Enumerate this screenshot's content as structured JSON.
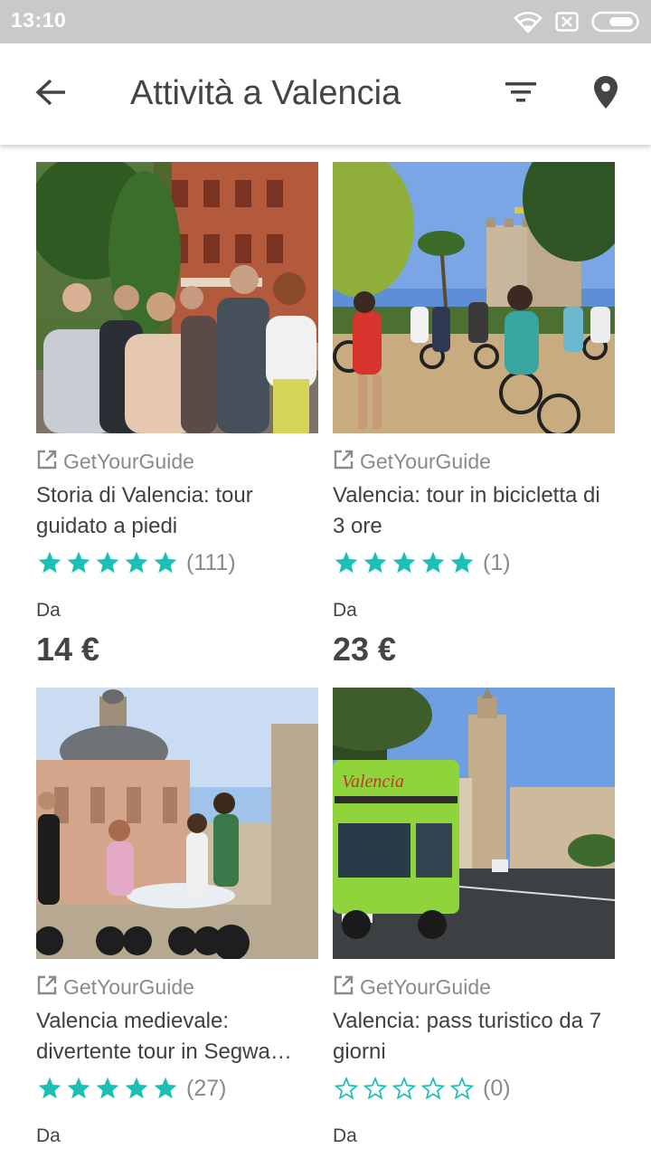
{
  "status_bar": {
    "time": "13:10",
    "icons": [
      "wifi-icon",
      "sim-missing-icon",
      "battery-icon"
    ]
  },
  "header": {
    "title": "Attività a Valencia",
    "icons": [
      "back-arrow-icon",
      "filter-icon",
      "map-pin-icon"
    ]
  },
  "colors": {
    "accent": "#1bbfb7",
    "status_bar": "#c9c9c9",
    "muted_text": "#8a8a8a"
  },
  "activities": [
    {
      "provider": "GetYourGuide",
      "title": "Storia di Valencia: tour guidato a piedi",
      "rating": 5,
      "reviews": "(111)",
      "price_label": "Da",
      "price": "14 €",
      "photo": "walking tour group in front of historic brick building"
    },
    {
      "provider": "GetYourGuide",
      "title": "Valencia: tour in bicicletta di 3 ore",
      "rating": 5,
      "reviews": "(1)",
      "price_label": "Da",
      "price": "23 €",
      "photo": "cyclists near Serranos towers"
    },
    {
      "provider": "GetYourGuide",
      "title": "Valencia medievale: divertente tour in Segwa…",
      "rating": 5,
      "reviews": "(27)",
      "price_label": "Da",
      "price": "",
      "photo": "segway riders near basilica fountain"
    },
    {
      "provider": "GetYourGuide",
      "title": "Valencia: pass turistico da 7 giorni",
      "rating": 0,
      "reviews": "(0)",
      "price_label": "Da",
      "price": "",
      "photo": "green tourist bus near cathedral tower"
    }
  ]
}
